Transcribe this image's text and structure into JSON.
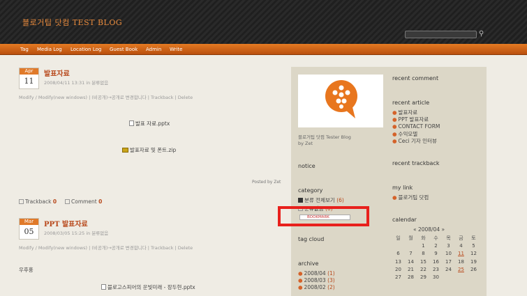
{
  "header": {
    "title": "블로거팁 닷컴 TEST BLOG",
    "search_placeholder": ""
  },
  "nav": [
    "Tag",
    "Media Log",
    "Location Log",
    "Guest Book",
    "Admin",
    "Write"
  ],
  "posts": [
    {
      "month": "Apr",
      "day": "11",
      "title": "발표자료",
      "meta": "2008/04/11 13:31 in 분류없음",
      "actions": "Modify / Modify(new windows) | (비공개)→공개로 변경합니다 | Trackback | Delete",
      "attachments": [
        "발표 자료.pptx",
        "발표자료 및 폰트.zip"
      ],
      "posted_by": "Posted by Zet",
      "trackback_label": "Trackback",
      "trackback_count": "0",
      "comment_label": "Comment",
      "comment_count": "0"
    },
    {
      "month": "Mar",
      "day": "05",
      "title": "PPT 발표자료",
      "meta": "2008/03/05 15:25 in 분류없음",
      "actions": "Modify / Modify(new windows) | (비공개)→공개로 변경합니다 | Trackback | Delete",
      "body": "우후훙",
      "attachments": [
        "블로고스피어의 운빛미래 - 장두현.pptx"
      ]
    }
  ],
  "sidebar": {
    "profile_caption": "블로거팁 닷컴 Tester Blog",
    "profile_by": "by Zet",
    "notice": "notice",
    "category": "category",
    "category_items": [
      {
        "label": "분류 전체보기",
        "count": "(6)"
      },
      {
        "label": "분류없음",
        "count": "(6)"
      }
    ],
    "bookmark_label": "BOOKMARK",
    "tag_cloud": "tag cloud",
    "archive": "archive",
    "archive_items": [
      {
        "label": "2008/04",
        "count": "(1)"
      },
      {
        "label": "2008/03",
        "count": "(3)"
      },
      {
        "label": "2008/02",
        "count": "(2)"
      }
    ],
    "recent_comment": "recent comment",
    "recent_article": "recent article",
    "recent_articles": [
      "발표자료",
      "PPT 발표자료",
      "CONTACT FORM",
      "수익모델",
      "Ceci 기자 인터뷰"
    ],
    "recent_trackback": "recent trackback",
    "my_link": "my link",
    "my_links": [
      "블로거팁 닷컴"
    ],
    "calendar": "calendar",
    "calendar_title": "«  2008/04  »",
    "calendar_days": [
      "일",
      "월",
      "화",
      "수",
      "목",
      "금",
      "토"
    ],
    "calendar_rows": [
      [
        "",
        "",
        "1",
        "2",
        "3",
        "4",
        "5"
      ],
      [
        "6",
        "7",
        "8",
        "9",
        "10",
        "11",
        "12"
      ],
      [
        "13",
        "14",
        "15",
        "16",
        "17",
        "18",
        "19"
      ],
      [
        "20",
        "21",
        "22",
        "23",
        "24",
        "25",
        "26"
      ],
      [
        "27",
        "28",
        "29",
        "30",
        "",
        "",
        ""
      ]
    ]
  },
  "colors": {
    "accent": "#e07a2a",
    "title": "#b8481b",
    "highlight": "#e8201c"
  }
}
